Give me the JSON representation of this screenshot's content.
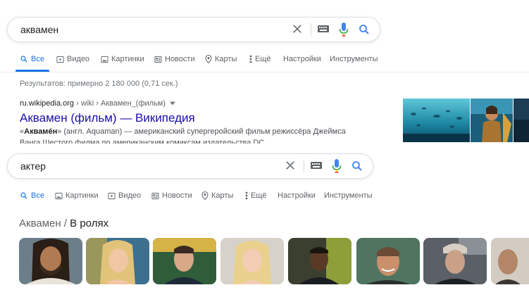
{
  "search1": {
    "query": "аквамен"
  },
  "tabs1": [
    {
      "label": "Все",
      "icon": "search-icon",
      "active": true
    },
    {
      "label": "Видео",
      "icon": "video-icon"
    },
    {
      "label": "Картинки",
      "icon": "image-icon"
    },
    {
      "label": "Новости",
      "icon": "news-icon"
    },
    {
      "label": "Карты",
      "icon": "map-pin-icon"
    },
    {
      "label": "Ещё",
      "icon": "more-vert-icon"
    },
    {
      "label": "Настройки"
    },
    {
      "label": "Инструменты"
    }
  ],
  "stats": "Результатов: примерно 2 180 000 (0,71 сек.)",
  "result": {
    "domain": "ru.wikipedia.org",
    "path": " › wiki › Аквамен_(фильм)",
    "title": "Аквамен (фильм) — Википедия",
    "snippet_open": "«",
    "snippet_bold": "Аквамéн",
    "snippet_rest": "» (англ. Aquaman) — американский супергеройский фильм режиссёра Джеймса",
    "snippet_line2": "Ванга Шестого филма по американским комиксам издательства DC"
  },
  "search2": {
    "query": "актер"
  },
  "tabs2": [
    {
      "label": "Все",
      "icon": "search-icon",
      "active": true
    },
    {
      "label": "Картинки",
      "icon": "image-icon"
    },
    {
      "label": "Видео",
      "icon": "video-icon"
    },
    {
      "label": "Новости",
      "icon": "news-icon"
    },
    {
      "label": "Карты",
      "icon": "map-pin-icon"
    },
    {
      "label": "Ещё",
      "icon": "more-vert-icon"
    },
    {
      "label": "Настройки"
    },
    {
      "label": "Инструменты"
    }
  ],
  "section": {
    "parent": "Аквамен",
    "divider": " / ",
    "child": "В ролях"
  },
  "colors": {
    "accent": "#1a73e8",
    "link": "#1a0dab"
  }
}
